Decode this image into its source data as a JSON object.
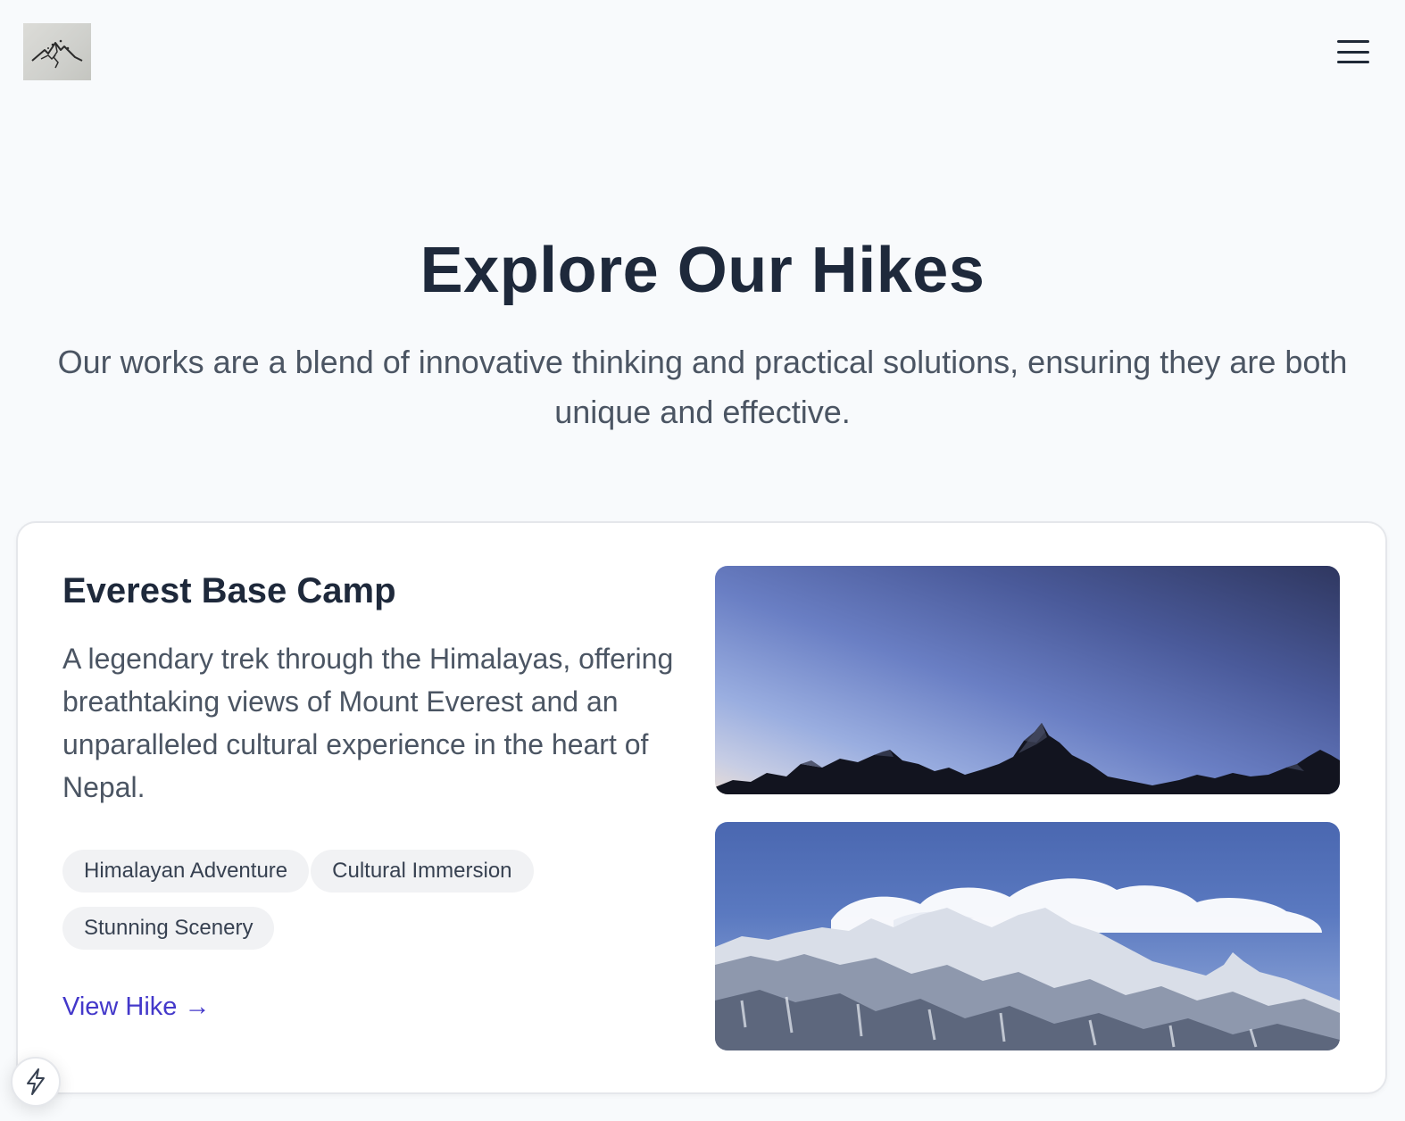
{
  "header": {
    "logo_icon": "mountain-logo-icon",
    "menu_icon": "hamburger-menu-icon"
  },
  "hero": {
    "title": "Explore Our Hikes",
    "subtitle": "Our works are a blend of innovative thinking and practical solutions, ensuring they are both unique and effective."
  },
  "hike": {
    "title": "Everest Base Camp",
    "description": "A legendary trek through the Himalayas, offering breathtaking views of Mount Everest and an unparalleled cultural experience in the heart of Nepal.",
    "tags": [
      "Himalayan Adventure",
      "Cultural Immersion",
      "Stunning Scenery"
    ],
    "link_label": "View Hike →",
    "images": [
      "mountain-silhouette-dusk",
      "snowy-peaks-clouds"
    ]
  },
  "floating_button": {
    "icon": "lightning-bolt-icon"
  },
  "colors": {
    "background": "#f8fafc",
    "heading": "#1e293b",
    "body_text": "#4b5563",
    "link": "#4338ca",
    "tag_bg": "#f1f2f4"
  }
}
